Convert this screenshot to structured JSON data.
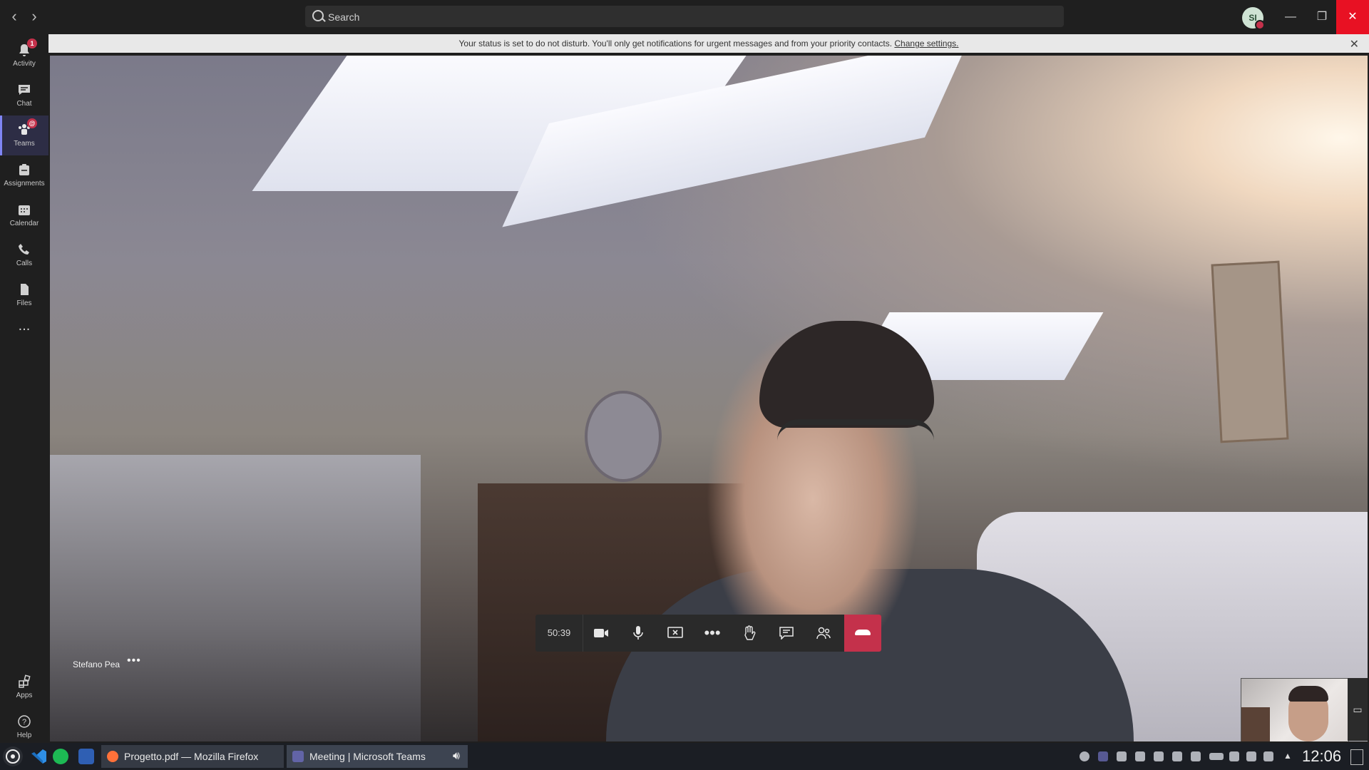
{
  "search": {
    "placeholder": "Search"
  },
  "user": {
    "initials": "SI"
  },
  "rail": {
    "items": [
      {
        "label": "Activity",
        "badge": "1"
      },
      {
        "label": "Chat"
      },
      {
        "label": "Teams",
        "badge": "@"
      },
      {
        "label": "Assignments"
      },
      {
        "label": "Calendar"
      },
      {
        "label": "Calls"
      },
      {
        "label": "Files"
      }
    ],
    "more": "...",
    "apps": "Apps",
    "help": "Help"
  },
  "notice": {
    "text": "Your status is set to do not disturb. You'll only get notifications for urgent messages and from your priority contacts.",
    "link": "Change settings."
  },
  "meeting": {
    "timer": "50:39",
    "participant_name": "Stefano Pea",
    "participant_more": "•••"
  },
  "taskbar": {
    "tasks": [
      {
        "label": "Progetto.pdf — Mozilla Firefox"
      },
      {
        "label": "Meeting | Microsoft Teams"
      }
    ],
    "time": "12:06"
  },
  "colors": {
    "accent": "#7f85f5",
    "hangup": "#c4314b",
    "close": "#e81123",
    "dnd": "#c4314b"
  }
}
